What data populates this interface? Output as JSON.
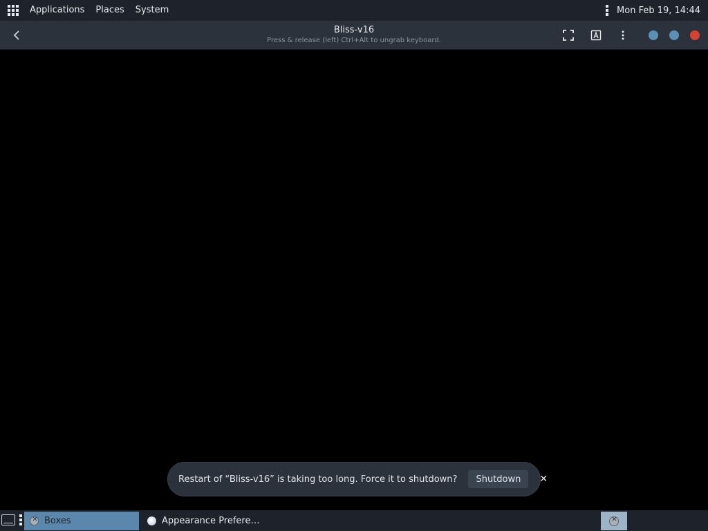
{
  "top_panel": {
    "menus": [
      "Applications",
      "Places",
      "System"
    ],
    "clock": "Mon Feb 19, 14:44"
  },
  "headerbar": {
    "title": "Bliss-v16",
    "subtitle": "Press & release (left) Ctrl+Alt to ungrab keyboard.",
    "icons": [
      "back-arrow",
      "fullscreen",
      "keyboard",
      "menu"
    ],
    "window_buttons": [
      {
        "name": "minimize",
        "color": "#5b8fb6"
      },
      {
        "name": "maximize",
        "color": "#5b8fb6"
      },
      {
        "name": "close",
        "color": "#d6422f"
      }
    ]
  },
  "notification": {
    "message": "Restart of “Bliss-v16” is taking too long. Force it to shutdown?",
    "action_label": "Shutdown",
    "close_glyph": "✕"
  },
  "taskbar": {
    "tasks": [
      {
        "label": "Boxes",
        "active": true,
        "icon": "boxes-icon"
      },
      {
        "label": "Appearance Prefere…",
        "active": false,
        "icon": "appearance-icon"
      }
    ]
  },
  "colors": {
    "panel_bg": "#1e232b",
    "headerbar_bg": "#2b323c",
    "active_task": "#5b87ad"
  }
}
